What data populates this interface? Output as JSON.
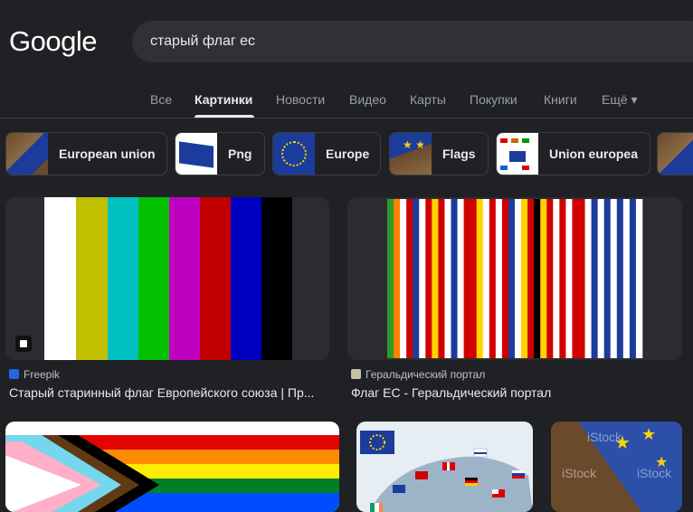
{
  "logo": "Google",
  "search": {
    "query": "старый флаг ес"
  },
  "tabs": [
    "Все",
    "Картинки",
    "Новости",
    "Видео",
    "Карты",
    "Покупки",
    "Книги",
    "Ещё ▾"
  ],
  "active_tab": "Картинки",
  "chips": [
    "European union",
    "Png",
    "Europe",
    "Flags",
    "Union europea"
  ],
  "results": [
    {
      "source": "Freepik",
      "title": "Старый старинный флаг Европейского союза | Пр..."
    },
    {
      "source": "Геральдический портал",
      "title": "Флаг ЕС - Геральдический портал"
    }
  ],
  "partial_thumbs": {
    "istock_label": "iStock"
  },
  "colors": {
    "background": "#202124",
    "search_bg": "#303134",
    "text": "#e8eaed",
    "muted": "#9aa0a6",
    "eu_blue": "#1c3c9c",
    "eu_star": "#ffd200"
  }
}
